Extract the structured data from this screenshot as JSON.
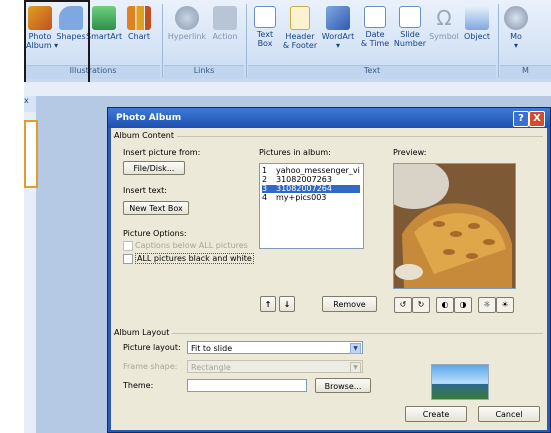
{
  "ribbon": {
    "buttons": [
      {
        "id": "photo-album",
        "label": "Photo\nAlbum ▾",
        "color": "#e0a020"
      },
      {
        "id": "shapes",
        "label": "Shapes",
        "color": "#5b8fd4"
      },
      {
        "id": "smartart",
        "label": "SmartArt",
        "color": "#3aa35a"
      },
      {
        "id": "chart",
        "label": "Chart",
        "color": "#e0a020"
      },
      {
        "id": "hyperlink",
        "label": "Hyperlink",
        "color": "#9aa8b9"
      },
      {
        "id": "action",
        "label": "Action",
        "color": "#9aa8b9"
      },
      {
        "id": "text-box",
        "label": "Text\nBox",
        "color": "#ffffff"
      },
      {
        "id": "header-footer",
        "label": "Header\n& Footer",
        "color": "#f5e7a8"
      },
      {
        "id": "wordart",
        "label": "WordArt\n▾",
        "color": "#4a73c4"
      },
      {
        "id": "date-time",
        "label": "Date\n& Time",
        "color": "#ffffff"
      },
      {
        "id": "slide-number",
        "label": "Slide\nNumber",
        "color": "#ffffff"
      },
      {
        "id": "symbol",
        "label": "Symbol",
        "color": "#9aa8b9"
      },
      {
        "id": "object",
        "label": "Object",
        "color": "#5b8fd4"
      },
      {
        "id": "movie",
        "label": "Mo\n▾",
        "color": "#7f8fa8"
      }
    ],
    "groups": {
      "illustrations": "Illustrations",
      "links": "Links",
      "text": "Text",
      "media": "M"
    }
  },
  "slide_tab_close": "x",
  "dialog": {
    "title": "Photo Album",
    "help": "?",
    "close": "X",
    "album_content": "Album Content",
    "insert_picture_from": "Insert picture from:",
    "file_disk": "File/Disk...",
    "insert_text": "Insert text:",
    "new_text_box": "New Text Box",
    "picture_options": "Picture Options:",
    "captions_below": "Captions below ALL pictures",
    "all_black_white": "ALL pictures black and white",
    "pictures_in_album": "Pictures in album:",
    "preview": "Preview:",
    "pictures": [
      {
        "n": "1",
        "name": "yahoo_messenger_vi",
        "selected": false
      },
      {
        "n": "2",
        "name": "31082007263",
        "selected": false
      },
      {
        "n": "3",
        "name": "31082007264",
        "selected": true
      },
      {
        "n": "4",
        "name": "my+pics003",
        "selected": false
      }
    ],
    "move_up": "↑",
    "move_down": "↓",
    "remove": "Remove",
    "album_layout": "Album Layout",
    "picture_layout_label": "Picture layout:",
    "picture_layout_value": "Fit to slide",
    "frame_shape_label": "Frame shape:",
    "frame_shape_value": "Rectangle",
    "theme_label": "Theme:",
    "theme_value": "",
    "browse": "Browse...",
    "create": "Create",
    "cancel": "Cancel"
  }
}
